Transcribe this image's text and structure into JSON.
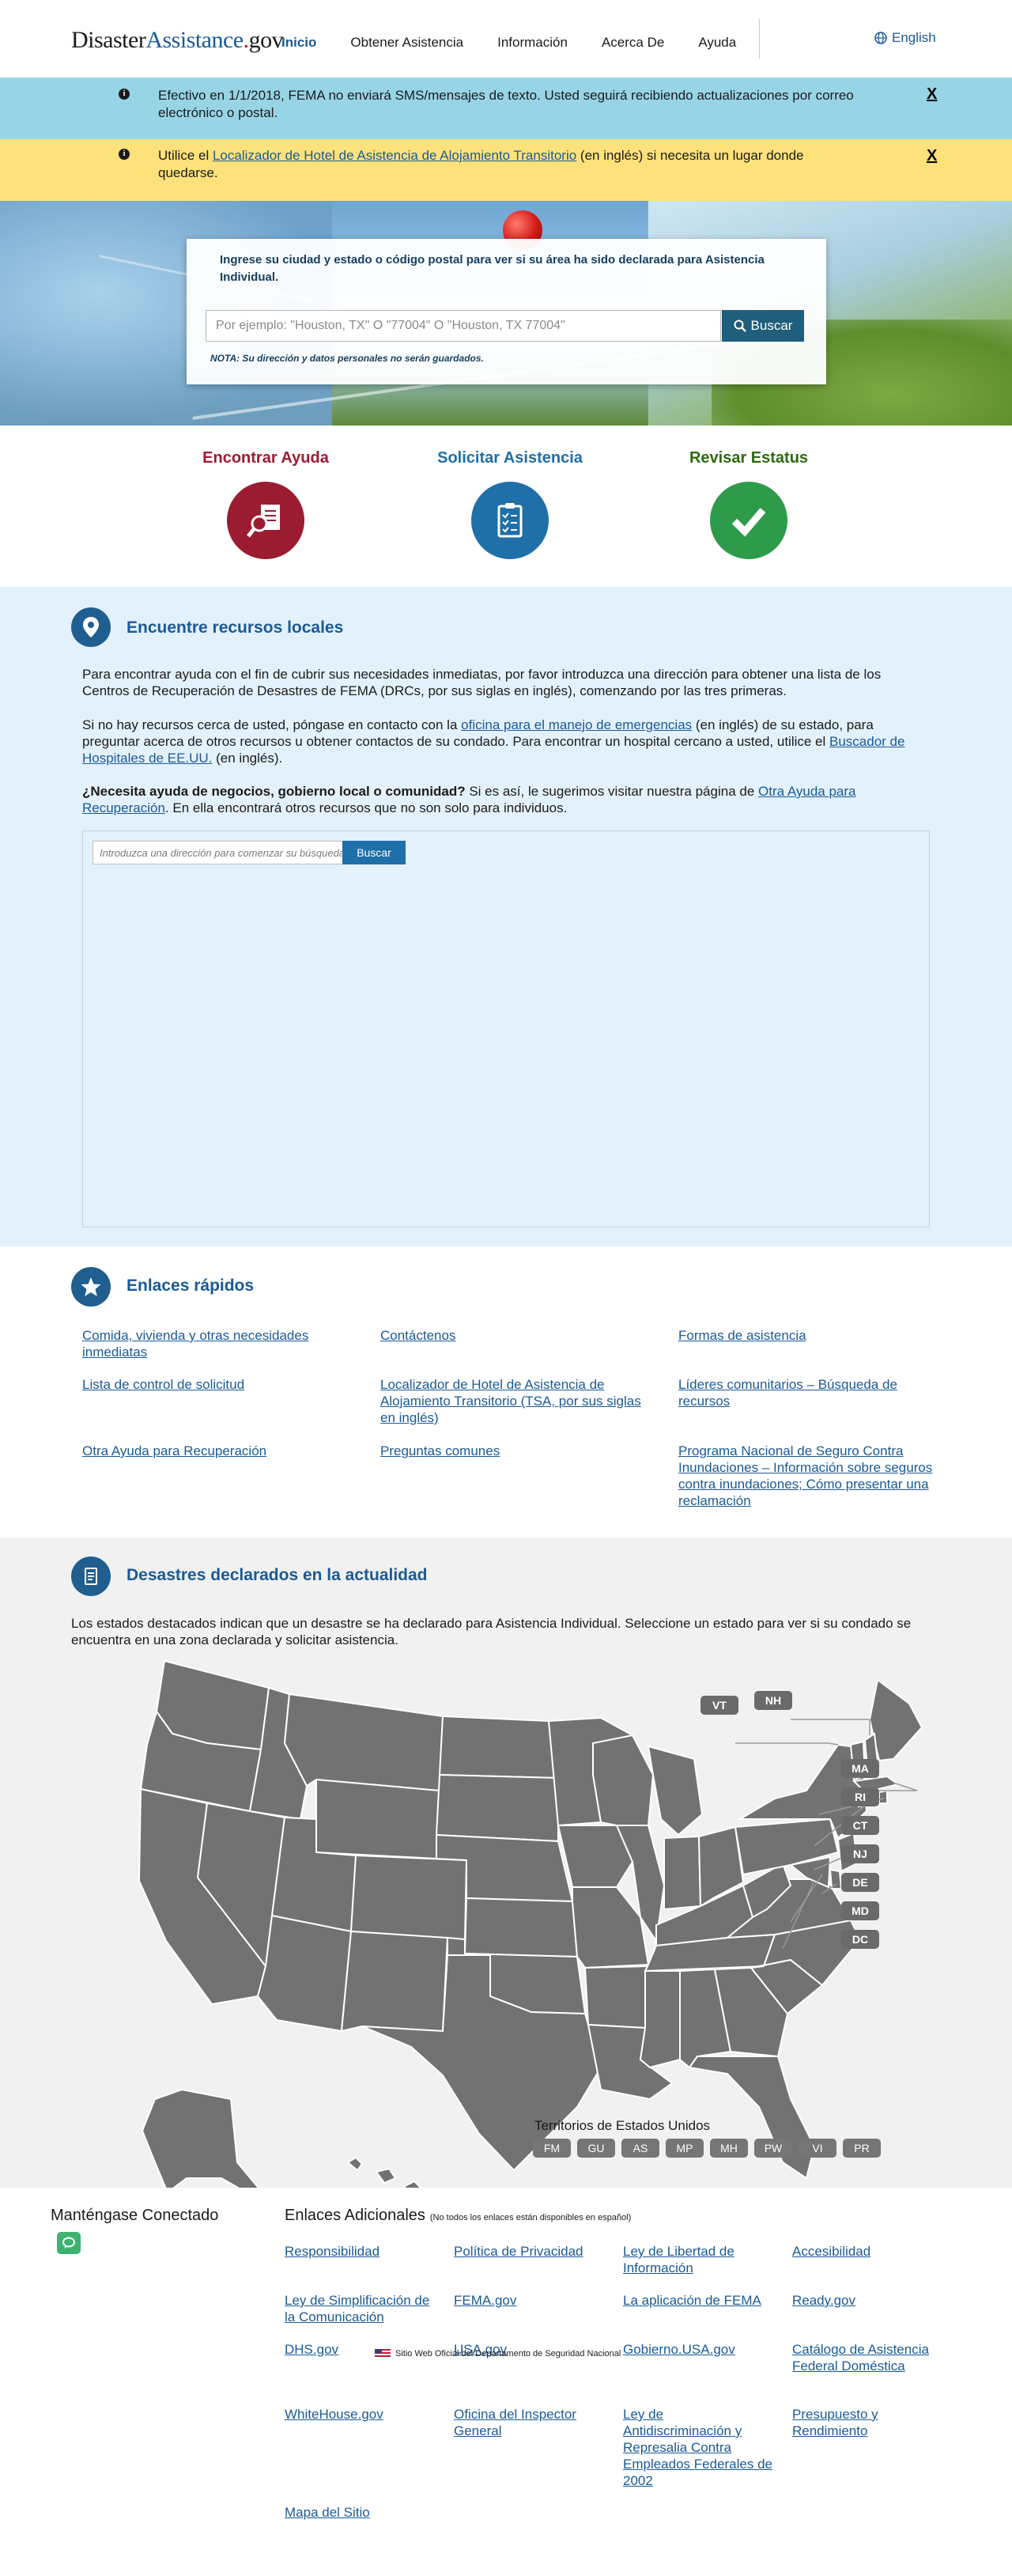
{
  "header": {
    "logo": {
      "part1": "Disaster",
      "part2": "Assistance",
      "dot": ".",
      "part3": "gov"
    },
    "nav": [
      "Inicio",
      "Obtener Asistencia",
      "Información",
      "Acerca De",
      "Ayuda"
    ],
    "language": "English"
  },
  "alerts": {
    "sms": "Efectivo en 1/1/2018, FEMA no enviará SMS/mensajes de texto. Usted seguirá recibiendo actualizaciones por correo electrónico o postal.",
    "hotel_pre": "Utilice el ",
    "hotel_link": "Localizador de Hotel de Asistencia de Alojamiento Transitorio",
    "hotel_post": " (en inglés) si necesita un lugar donde quedarse.",
    "close": "X"
  },
  "hero": {
    "prompt": "Ingrese su ciudad y estado o código postal para ver si su área ha sido declarada para Asistencia Individual.",
    "placeholder": "Por ejemplo: \"Houston, TX\" O \"77004\" O \"Houston, TX 77004\"",
    "button": "Buscar",
    "note": "NOTA: Su dirección y datos personales no serán guardados."
  },
  "steps": [
    {
      "label": "Encontrar Ayuda",
      "color": "#9b1c31"
    },
    {
      "label": "Solicitar Asistencia",
      "color": "#1f6fa8"
    },
    {
      "label": "Revisar Estatus",
      "color": "#2e8540"
    }
  ],
  "local": {
    "title": "Encuentre recursos locales",
    "p1": "Para encontrar ayuda con el fin de cubrir sus necesidades inmediatas, por favor introduzca una dirección para obtener una lista de los Centros de Recuperación de Desastres de FEMA (DRCs, por sus siglas en inglés), comenzando por las tres primeras.",
    "p2_a": "Si no hay recursos cerca de usted, póngase en contacto con la ",
    "p2_link1": "oficina para el manejo de emergencias",
    "p2_b": " (en inglés) de su estado, para preguntar acerca de otros recursos u obtener contactos de su condado. Para encontrar un hospital cercano a usted, utilice el ",
    "p2_link2": "Buscador de Hospitales de EE.UU.",
    "p2_c": " (en inglés).",
    "p3_bold": "¿Necesita ayuda de negocios, gobierno local o comunidad?",
    "p3_a": " Si es así, le sugerimos visitar nuestra página de ",
    "p3_link": "Otra Ayuda para Recuperación",
    "p3_b": ". En ella encontrará otros recursos que no son solo para individuos.",
    "map_placeholder": "Introduzca una dirección para comenzar su búsqueda",
    "map_button": "Buscar"
  },
  "quick": {
    "title": "Enlaces rápidos",
    "links": [
      "Comida, vivienda y otras necesidades inmediatas",
      "Contáctenos",
      "Formas de asistencia",
      "Lista de control de solicitud",
      "Localizador de Hotel de Asistencia de Alojamiento Transitorio (TSA, por sus siglas en inglés)",
      "Líderes comunitarios – Búsqueda de recursos",
      "Otra Ayuda para Recuperación",
      "Preguntas comunes",
      "Programa Nacional de Seguro Contra Inundaciones – Información sobre seguros contra inundaciones; Cómo presentar una reclamación"
    ]
  },
  "disasters": {
    "title": "Desastres declarados en la actualidad",
    "desc": "Los estados destacados indican que un desastre se ha declarado para Asistencia Individual. Seleccione un estado para ver si su condado se encuentra en una zona declarada y solicitar asistencia.",
    "small_states": [
      "VT",
      "NH",
      "MA",
      "RI",
      "CT",
      "NJ",
      "DE",
      "MD",
      "DC"
    ],
    "territories_title": "Territorios de Estados Unidos",
    "territories": [
      "FM",
      "GU",
      "AS",
      "MP",
      "MH",
      "PW",
      "VI",
      "PR"
    ]
  },
  "footer": {
    "stay": "Manténgase Conectado",
    "addl_title": "Enlaces Adicionales",
    "addl_sub": "(No todos los enlaces están disponibles en español)",
    "links": [
      "Responsibilidad",
      "Política de Privacidad",
      "Ley de Libertad de Información",
      "Accesibilidad",
      "Ley de Simplificación de la Comunicación",
      "FEMA.gov",
      "La aplicación de FEMA",
      "Ready.gov",
      "DHS.gov",
      "USA.gov",
      "Gobierno.USA.gov",
      "Catálogo de Asistencia Federal Doméstica",
      "WhiteHouse.gov",
      "Oficina del Inspector General",
      "Ley de Antidiscriminación y Represalia Contra Empleados Federales de 2002",
      "Presupuesto y Rendimiento",
      "Mapa del Sitio"
    ],
    "official": "Sitio Web Oficial del Departamento de Seguridad Nacional"
  }
}
